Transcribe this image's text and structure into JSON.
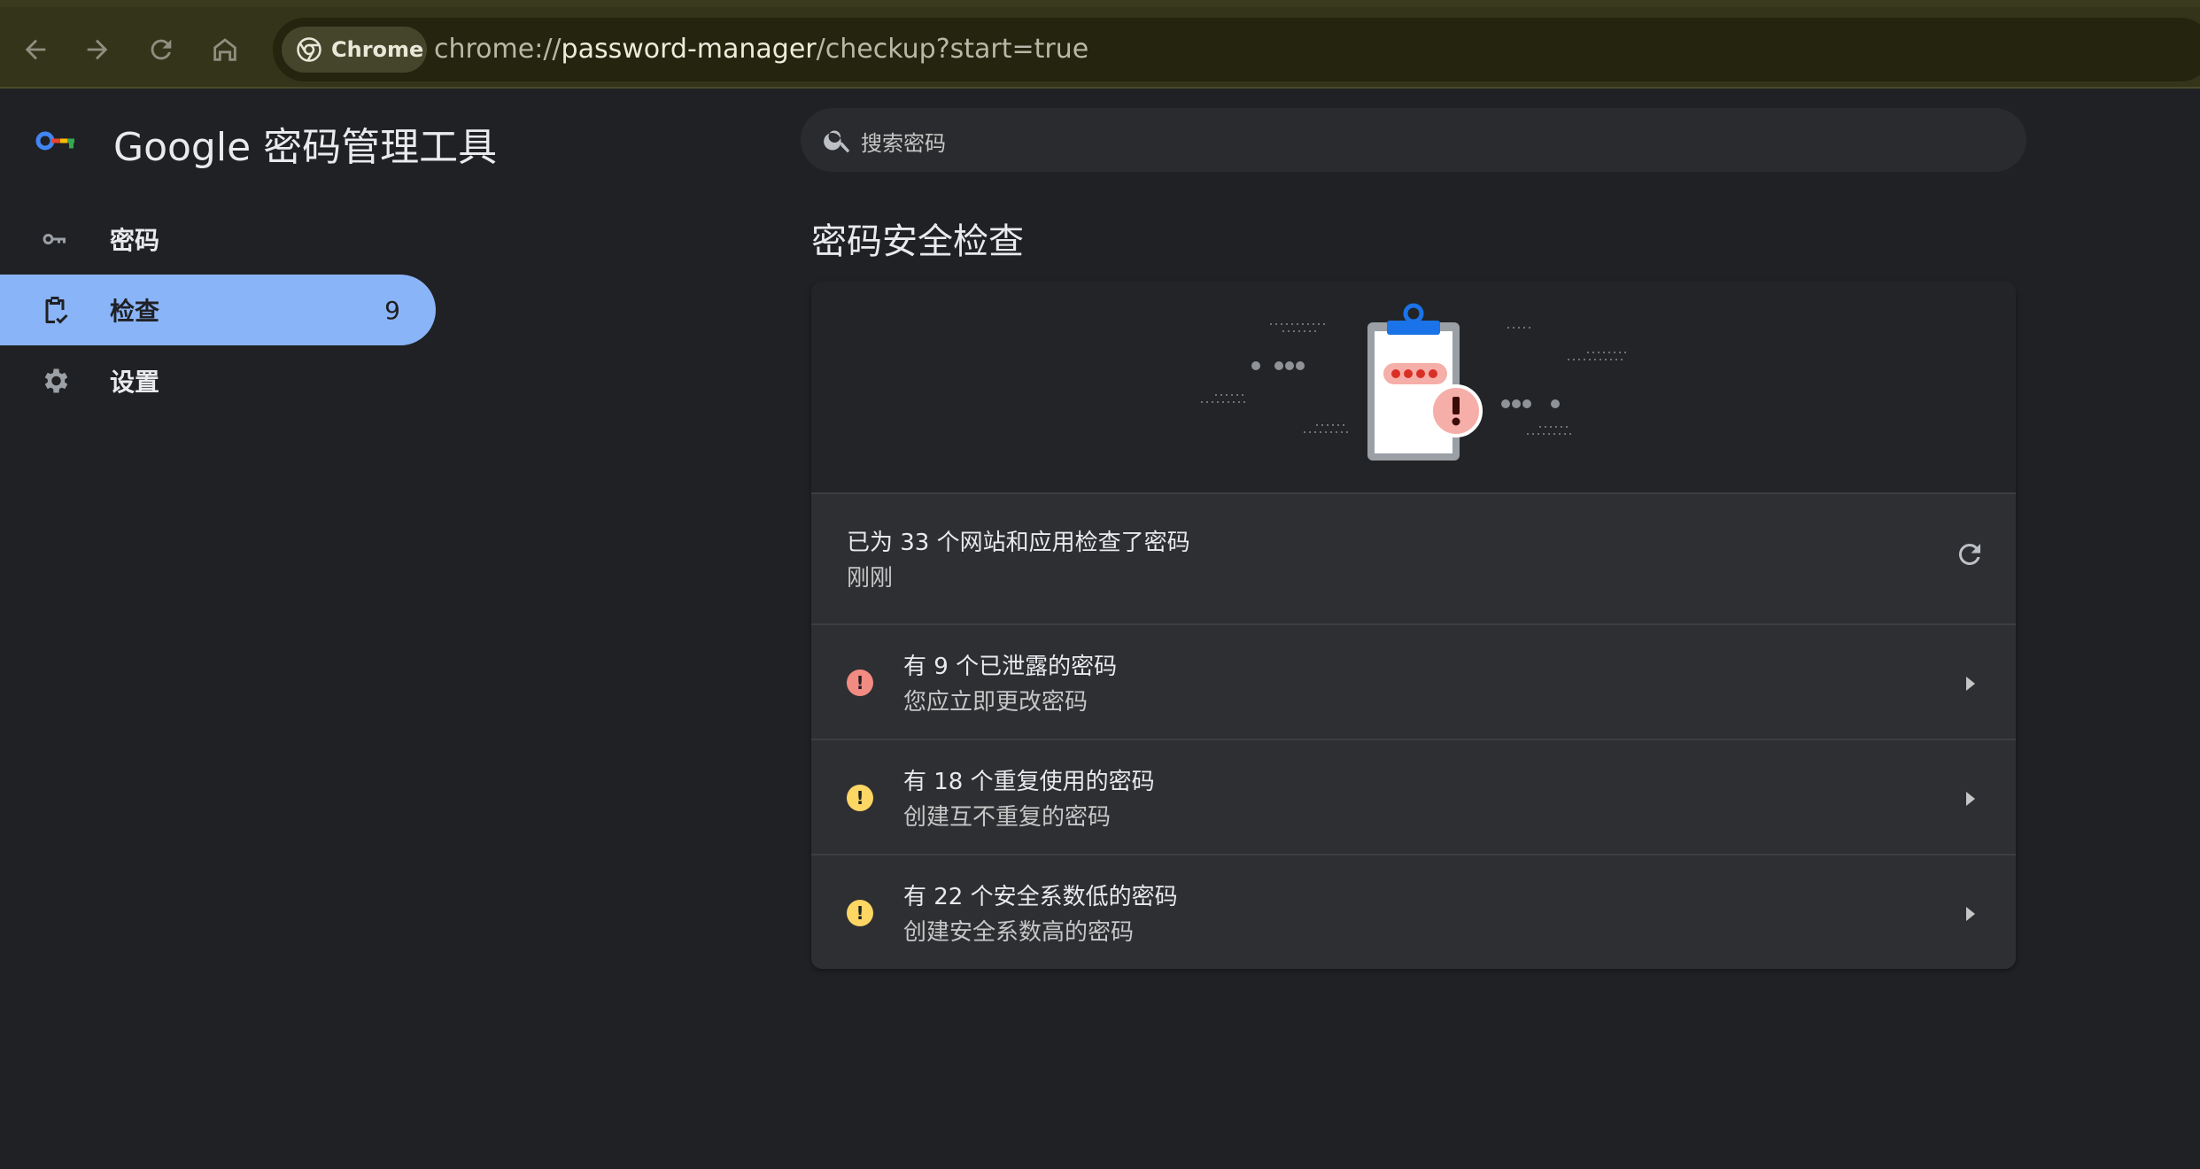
{
  "browser": {
    "chip_label": "Chrome",
    "url_scheme": "chrome://",
    "url_host": "password-manager",
    "url_path": "/checkup?start=true"
  },
  "app": {
    "title": "Google 密码管理工具"
  },
  "sidebar": {
    "items": [
      {
        "label": "密码",
        "icon": "key-icon"
      },
      {
        "label": "检查",
        "icon": "checkup-icon",
        "count": "9"
      },
      {
        "label": "设置",
        "icon": "gear-icon"
      }
    ]
  },
  "search": {
    "placeholder": "搜索密码"
  },
  "main": {
    "title": "密码安全检查",
    "summary": {
      "line1": "已为 33 个网站和应用检查了密码",
      "line2": "刚刚"
    },
    "issues": [
      {
        "title": "有 9 个已泄露的密码",
        "subtitle": "您应立即更改密码",
        "severity_color": "#f28b82"
      },
      {
        "title": "有 18 个重复使用的密码",
        "subtitle": "创建互不重复的密码",
        "severity_color": "#fdd663"
      },
      {
        "title": "有 22 个安全系数低的密码",
        "subtitle": "创建安全系数高的密码",
        "severity_color": "#fdd663"
      }
    ]
  },
  "colors": {
    "accent": "#8ab4f8",
    "background": "#202124",
    "card": "#2e2f33"
  }
}
